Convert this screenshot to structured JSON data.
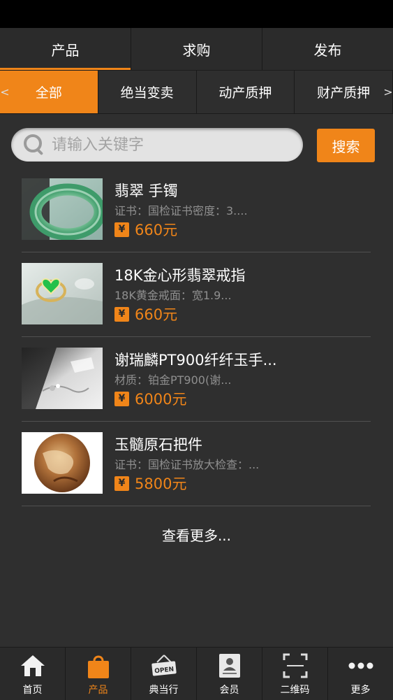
{
  "top_tabs": [
    {
      "label": "产品",
      "active": true
    },
    {
      "label": "求购",
      "active": false
    },
    {
      "label": "发布",
      "active": false
    }
  ],
  "categories": {
    "left_arrow": "<",
    "right_arrow": ">",
    "items": [
      {
        "label": "全部",
        "active": true
      },
      {
        "label": "绝当变卖",
        "active": false
      },
      {
        "label": "动产质押",
        "active": false
      },
      {
        "label": "财产质押",
        "active": false
      }
    ]
  },
  "search": {
    "placeholder": "请输入关键字",
    "button_label": "搜索"
  },
  "products": [
    {
      "name": "翡翠 手镯",
      "desc": "证书：国检证书密度：3....",
      "currency": "¥",
      "price": "660元"
    },
    {
      "name": "18K金心形翡翠戒指",
      "desc": "18K黄金戒面：宽1.9...",
      "currency": "¥",
      "price": "660元"
    },
    {
      "name": "谢瑞麟PT900纤纤玉手...",
      "desc": "材质：铂金PT900(谢...",
      "currency": "¥",
      "price": "6000元"
    },
    {
      "name": "玉髓原石把件",
      "desc": "证书：国检证书放大检查：...",
      "currency": "¥",
      "price": "5800元"
    }
  ],
  "more_label": "查看更多...",
  "bottom_nav": [
    {
      "label": "首页",
      "icon": "home-icon",
      "active": false
    },
    {
      "label": "产品",
      "icon": "shopping-bag-icon",
      "active": true
    },
    {
      "label": "典当行",
      "icon": "open-sign-icon",
      "active": false
    },
    {
      "label": "会员",
      "icon": "member-card-icon",
      "active": false
    },
    {
      "label": "二维码",
      "icon": "qr-scan-icon",
      "active": false
    },
    {
      "label": "更多",
      "icon": "more-dots-icon",
      "active": false
    }
  ],
  "colors": {
    "accent": "#f08519",
    "background": "#2f2f2f"
  }
}
